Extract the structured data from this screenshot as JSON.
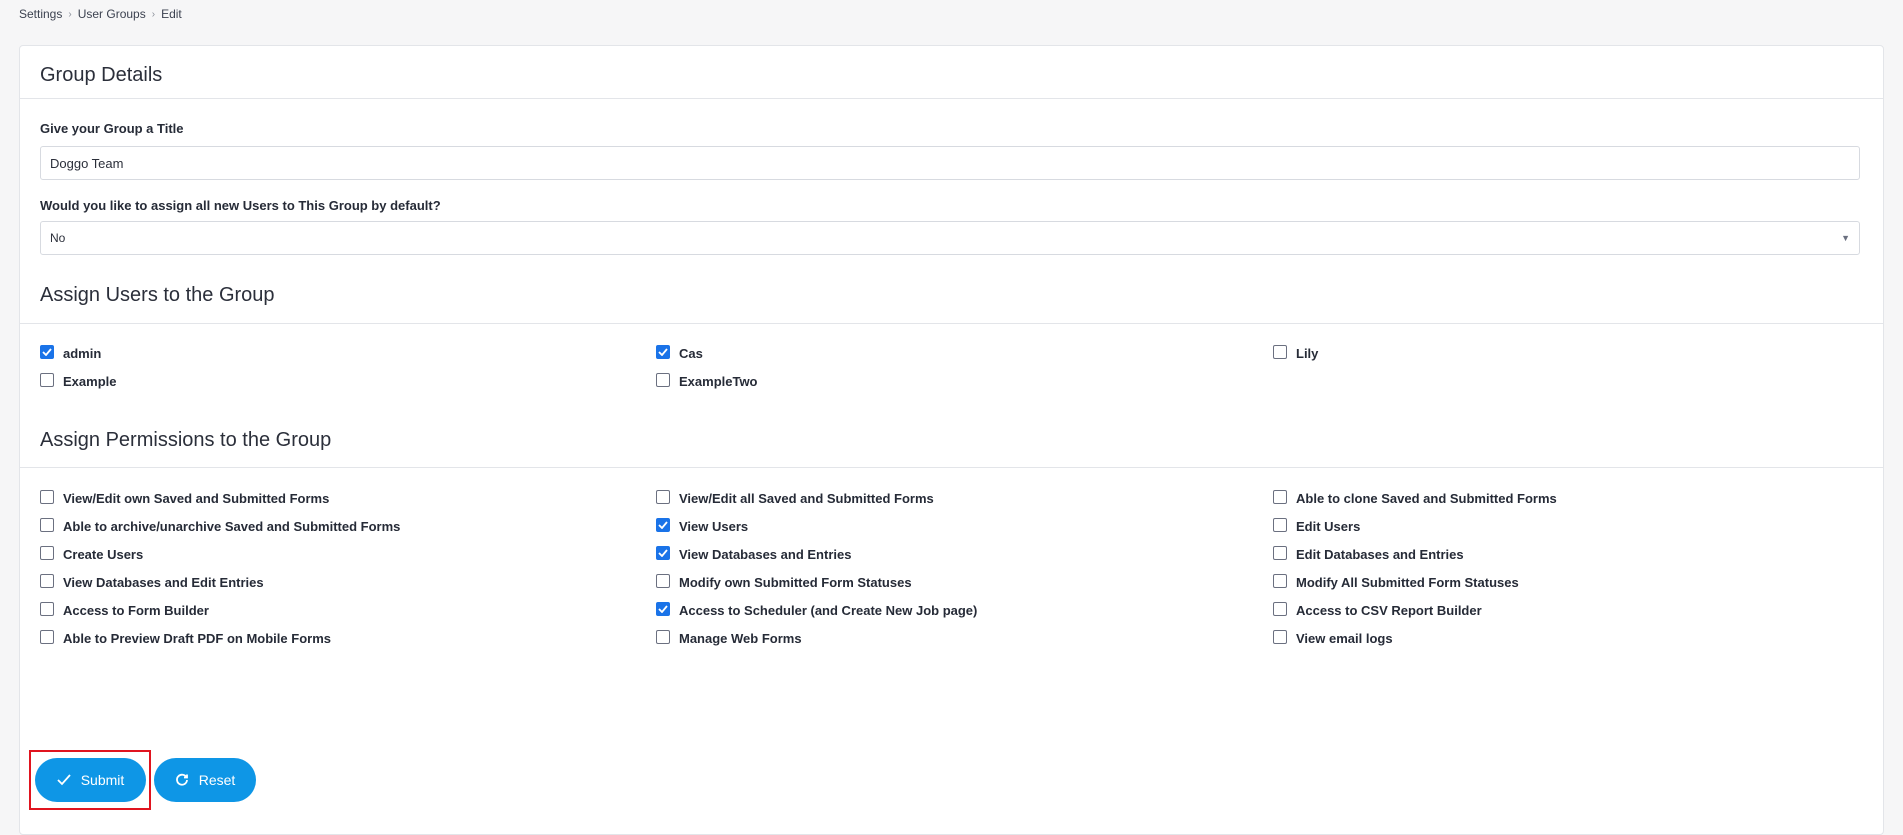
{
  "breadcrumb": {
    "items": [
      "Settings",
      "User Groups",
      "Edit"
    ],
    "separator": "›"
  },
  "group_details": {
    "title": "Group Details",
    "title_label": "Give your Group a Title",
    "title_value": "Doggo Team",
    "default_label": "Would you like to assign all new Users to This Group by default?",
    "default_value": "No"
  },
  "users": {
    "title": "Assign Users to the Group",
    "items": [
      {
        "label": "admin",
        "checked": true
      },
      {
        "label": "Cas",
        "checked": true
      },
      {
        "label": "Lily",
        "checked": false
      },
      {
        "label": "Example",
        "checked": false
      },
      {
        "label": "ExampleTwo",
        "checked": false
      }
    ]
  },
  "permissions": {
    "title": "Assign Permissions to the Group",
    "items": [
      {
        "label": "View/Edit own Saved and Submitted Forms",
        "checked": false
      },
      {
        "label": "View/Edit all Saved and Submitted Forms",
        "checked": false
      },
      {
        "label": "Able to clone Saved and Submitted Forms",
        "checked": false
      },
      {
        "label": "Able to archive/unarchive Saved and Submitted Forms",
        "checked": false
      },
      {
        "label": "View Users",
        "checked": true
      },
      {
        "label": "Edit Users",
        "checked": false
      },
      {
        "label": "Create Users",
        "checked": false
      },
      {
        "label": "View Databases and Entries",
        "checked": true
      },
      {
        "label": "Edit Databases and Entries",
        "checked": false
      },
      {
        "label": "View Databases and Edit Entries",
        "checked": false
      },
      {
        "label": "Modify own Submitted Form Statuses",
        "checked": false
      },
      {
        "label": "Modify All Submitted Form Statuses",
        "checked": false
      },
      {
        "label": "Access to Form Builder",
        "checked": false
      },
      {
        "label": "Access to Scheduler (and Create New Job page)",
        "checked": true
      },
      {
        "label": "Access to CSV Report Builder",
        "checked": false
      },
      {
        "label": "Able to Preview Draft PDF on Mobile Forms",
        "checked": false
      },
      {
        "label": "Manage Web Forms",
        "checked": false
      },
      {
        "label": "View email logs",
        "checked": false
      }
    ]
  },
  "actions": {
    "submit_label": "Submit",
    "reset_label": "Reset"
  },
  "colors": {
    "accent": "#0e96e6",
    "checkbox_checked": "#1a73e8",
    "highlight": "#e0141f"
  }
}
